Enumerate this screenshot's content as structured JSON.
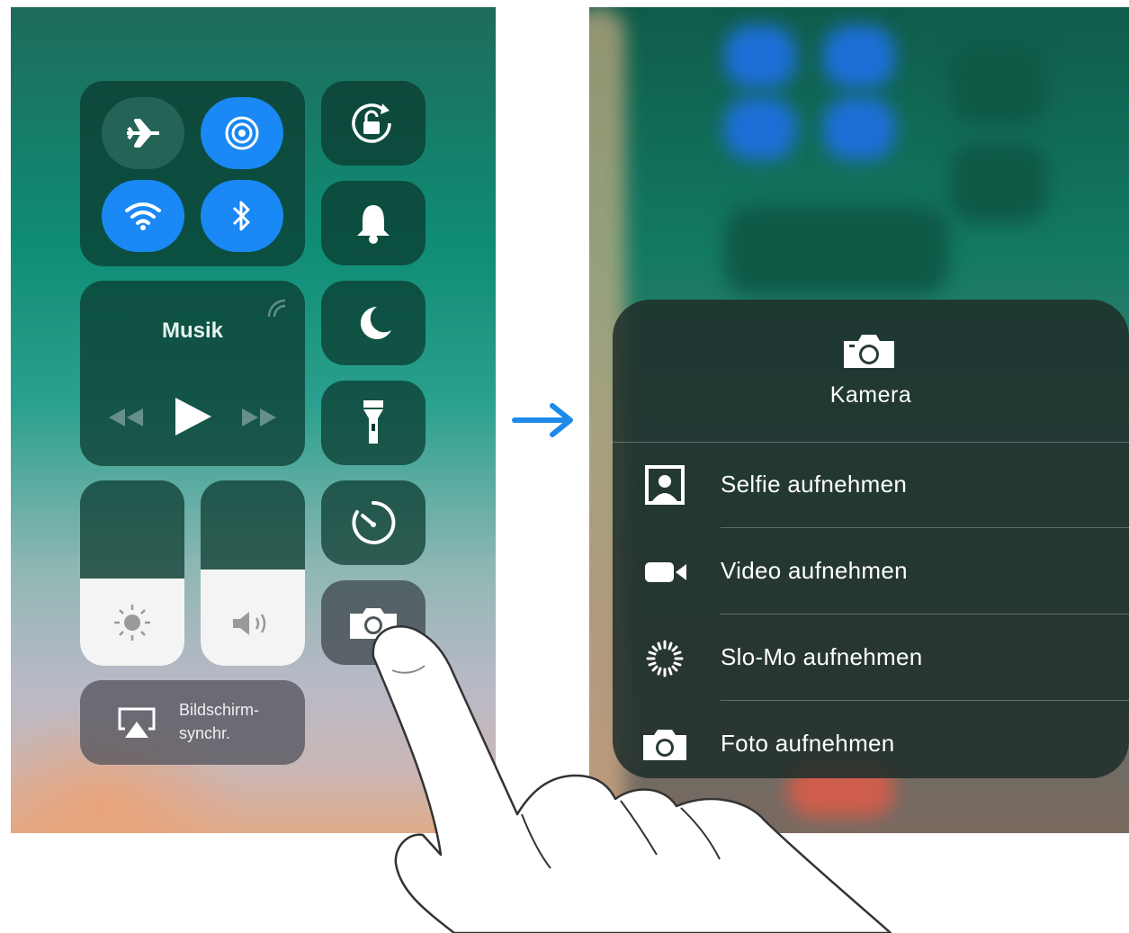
{
  "control_center": {
    "music": {
      "title": "Musik"
    },
    "screen_mirroring": {
      "label_line1": "Bildschirm-",
      "label_line2": "synchr."
    },
    "brightness_level": 0.47,
    "volume_level": 0.52,
    "connectivity": {
      "airplane": "off",
      "airdrop": "on",
      "wifi": "on",
      "bluetooth": "on"
    }
  },
  "camera_menu": {
    "title": "Kamera",
    "items": [
      {
        "label": "Selfie aufnehmen",
        "icon": "selfie-icon"
      },
      {
        "label": "Video aufnehmen",
        "icon": "video-camera-icon"
      },
      {
        "label": "Slo-Mo aufnehmen",
        "icon": "slomo-icon"
      },
      {
        "label": "Foto aufnehmen",
        "icon": "camera-icon"
      }
    ]
  },
  "colors": {
    "accent_blue": "#1a88f5",
    "arrow_blue": "#1e8be8"
  }
}
